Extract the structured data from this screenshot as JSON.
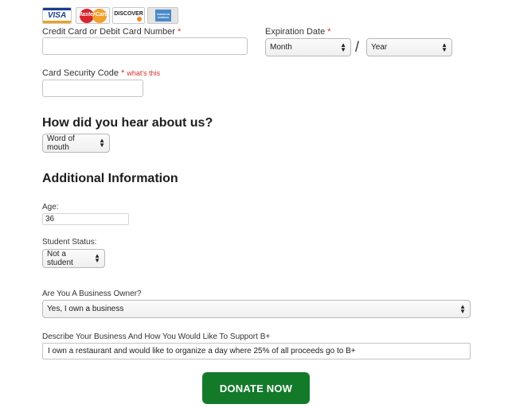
{
  "cards": {
    "visa": "VISA",
    "mastercard": "MasterCard",
    "discover": "DISCOVER",
    "amex": "AMERICAN EXPRESS"
  },
  "payment": {
    "card_number_label": "Credit Card or Debit Card Number",
    "required_mark": "*",
    "card_number_value": "",
    "expiration_label": "Expiration Date",
    "month_value": "Month",
    "year_value": "Year",
    "separator": "/",
    "security_code_label": "Card Security Code",
    "whats_this": "what's this",
    "security_code_value": ""
  },
  "hear_about": {
    "heading": "How did you hear about us?",
    "selected": "Word of mouth"
  },
  "additional": {
    "heading": "Additional Information",
    "age_label": "Age:",
    "age_value": "36",
    "student_label": "Student Status:",
    "student_value": "Not a student",
    "business_owner_label": "Are You A Business Owner?",
    "business_owner_value": "Yes, I own a business",
    "describe_label": "Describe Your Business And How You Would Like To Support B+",
    "describe_value": "I own a restaurant and would like to organize a day where 25% of all proceeds go to B+"
  },
  "submit": {
    "label": "DONATE NOW"
  },
  "colors": {
    "button": "#137a2a",
    "required": "#d0342c"
  }
}
